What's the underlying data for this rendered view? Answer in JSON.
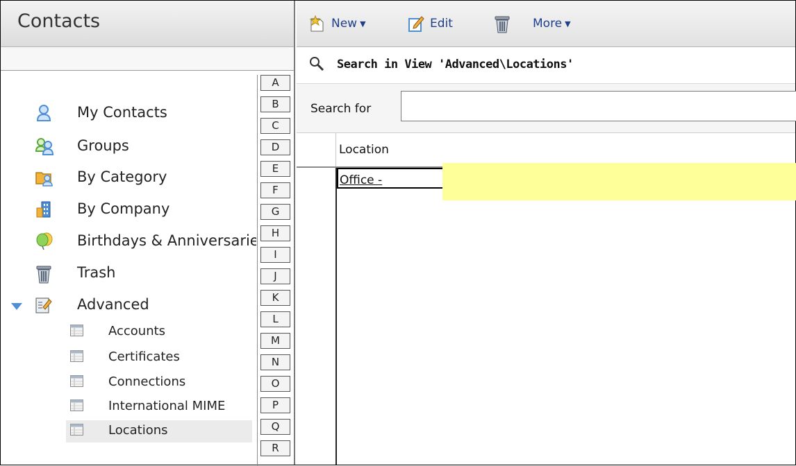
{
  "left": {
    "title": "Contacts",
    "nav_items": [
      {
        "label": "My Contacts",
        "icon": "person-icon"
      },
      {
        "label": "Groups",
        "icon": "group-icon"
      },
      {
        "label": "By Category",
        "icon": "category-folder-icon"
      },
      {
        "label": "By Company",
        "icon": "building-icon"
      },
      {
        "label": "Birthdays & Anniversaries",
        "icon": "balloon-icon"
      },
      {
        "label": "Trash",
        "icon": "trash-icon"
      },
      {
        "label": "Advanced",
        "icon": "advanced-icon"
      }
    ],
    "advanced_items": [
      {
        "label": "Accounts"
      },
      {
        "label": "Certificates"
      },
      {
        "label": "Connections"
      },
      {
        "label": "International MIME"
      },
      {
        "label": "Locations"
      }
    ],
    "selected_item": "Locations",
    "alphabet": [
      "A",
      "B",
      "C",
      "D",
      "E",
      "F",
      "G",
      "H",
      "I",
      "J",
      "K",
      "L",
      "M",
      "N",
      "O",
      "P",
      "Q",
      "R"
    ]
  },
  "toolbar": {
    "new_label": "New",
    "edit_label": "Edit",
    "more_label": "More"
  },
  "search": {
    "heading": "Search in View 'Advanced\\Locations'",
    "label": "Search for",
    "value": ""
  },
  "grid": {
    "column": "Location",
    "rows": [
      {
        "location": "Office - "
      }
    ]
  },
  "colors": {
    "toolbar_text": "#1f3f8a",
    "highlight": "#ffff99",
    "selection": "#ebebeb"
  }
}
